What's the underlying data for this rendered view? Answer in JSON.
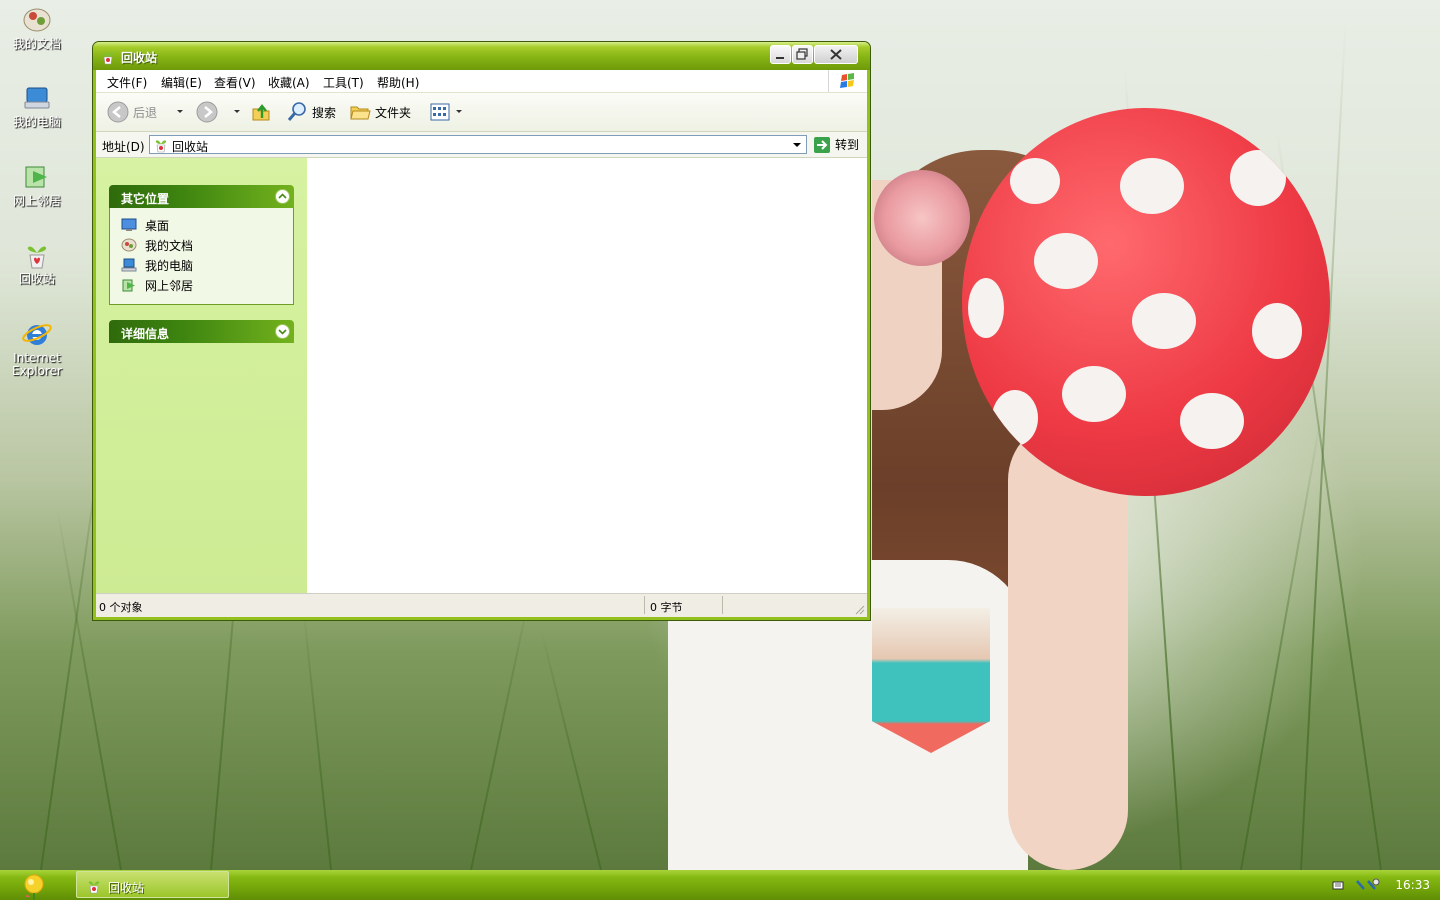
{
  "desktop": {
    "icons": [
      {
        "label": "我的文档"
      },
      {
        "label": "我的电脑"
      },
      {
        "label": "网上邻居"
      },
      {
        "label": "回收站"
      },
      {
        "label": "Internet Explorer"
      }
    ]
  },
  "window": {
    "title": "回收站",
    "menu": [
      "文件(F)",
      "编辑(E)",
      "查看(V)",
      "收藏(A)",
      "工具(T)",
      "帮助(H)"
    ],
    "toolbar": {
      "back": "后退",
      "search": "搜索",
      "folders": "文件夹"
    },
    "address": {
      "label": "地址(D)",
      "value": "回收站",
      "go": "转到"
    },
    "left_panel": {
      "other_places": {
        "title": "其它位置",
        "items": [
          "桌面",
          "我的文档",
          "我的电脑",
          "网上邻居"
        ]
      },
      "details": {
        "title": "详细信息"
      }
    },
    "status": {
      "objects": "0 个对象",
      "size": "0 字节"
    }
  },
  "taskbar": {
    "item_label": "回收站",
    "clock": "16:33"
  },
  "colors": {
    "title_green": "#86b314",
    "pane_green": "#d6f2a2",
    "taskbar_green": "#74a60a"
  }
}
